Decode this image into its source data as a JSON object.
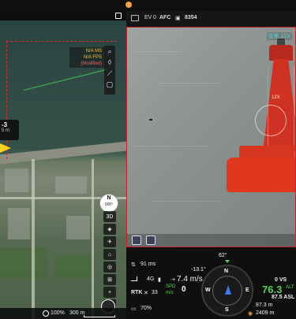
{
  "map": {
    "wp_label_short": "-3",
    "wp_label_dist": "5 m",
    "overlay_line1": "N/A MS",
    "overlay_line2": "N/A FPS",
    "overlay_line3": "(Modified)",
    "compass_n": "N",
    "compass_deg": "000°",
    "btn_3d": "3D",
    "btn_plus": "+",
    "btn_minus": "−",
    "zoom_pct": "100%",
    "scale_text": "300 m"
  },
  "camera": {
    "ev_label": "EV",
    "ev_value": "0",
    "afc_label": "AFC",
    "storage_value": "8354",
    "zoom_badge": "变焦 12X",
    "buoy_text": "12X"
  },
  "telemetry": {
    "latency": "91 ms",
    "link_4g": "4G",
    "rtk_label": "RTK",
    "rtk_sats": "33",
    "hspeed": "7.4 m/s",
    "spd_label": "SPD",
    "spd_unit": "m/s",
    "spd_value": "0",
    "battery": "70%",
    "heading_top": "62°",
    "pitch": "-13.1°",
    "dist_home": "87.3 m",
    "range": "2409 m",
    "vs_label": "0 VS",
    "alt_label": "ALT",
    "alt_value": "76.3",
    "alt_asl": "87.5 ASL",
    "card_n": "N",
    "card_e": "E",
    "card_s": "S",
    "card_w": "W"
  },
  "colors": {
    "accent": "#f2a53a",
    "alert_red": "#c2242b",
    "ok_green": "#5ad05a"
  }
}
